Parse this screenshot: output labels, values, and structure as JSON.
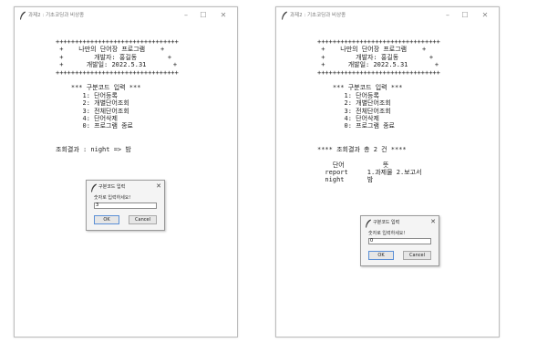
{
  "windows": [
    {
      "title": "과제2 : 기초코딩과 비상종",
      "controls": {
        "minimize": "–",
        "maximize": "☐",
        "close": "✕"
      },
      "console": "++++++++++++++++++++++++++++++++\n +    나만의 단어장 프로그램    +\n +        개발자: 홍길동        +\n +      개발일: 2022.5.31       +\n++++++++++++++++++++++++++++++++\n\n    *** 구분코드 입력 ***\n       1: 단어등록\n       2: 개별단어조회\n       3: 전체단어조회\n       4: 단어삭제\n       0: 프로그램 종료\n\n\n조회결과 : night => 밤",
      "dialog": {
        "title": "구분코드 입력",
        "close": "✕",
        "prompt": "숫자로 입력하세요!",
        "value": "3",
        "ok": "OK",
        "cancel": "Cancel"
      }
    },
    {
      "title": "과제2 : 기초코딩과 비상종",
      "controls": {
        "minimize": "–",
        "maximize": "☐",
        "close": "✕"
      },
      "console": "++++++++++++++++++++++++++++++++\n +    나만의 단어장 프로그램    +\n +        개발자: 홍길동        +\n +      개발일: 2022.5.31       +\n++++++++++++++++++++++++++++++++\n\n    *** 구분코드 입력 ***\n       1: 단어등록\n       2: 개별단어조회\n       3: 전체단어조회\n       4: 단어삭제\n       0: 프로그램 종료\n\n\n**** 조회결과 총 2 건 ****\n\n    단어          뜻\n  report     1.과제물 2.보고서\n  night      밤",
      "dialog": {
        "title": "구분코드 입력",
        "close": "✕",
        "prompt": "숫자로 입력하세요!",
        "value": "0",
        "ok": "OK",
        "cancel": "Cancel"
      }
    }
  ],
  "colors": {
    "window_border": "#bdbdbd",
    "dialog_bg": "#f4f4f4",
    "ok_border": "#5b8fd6",
    "feather": "#3a3a3a"
  }
}
